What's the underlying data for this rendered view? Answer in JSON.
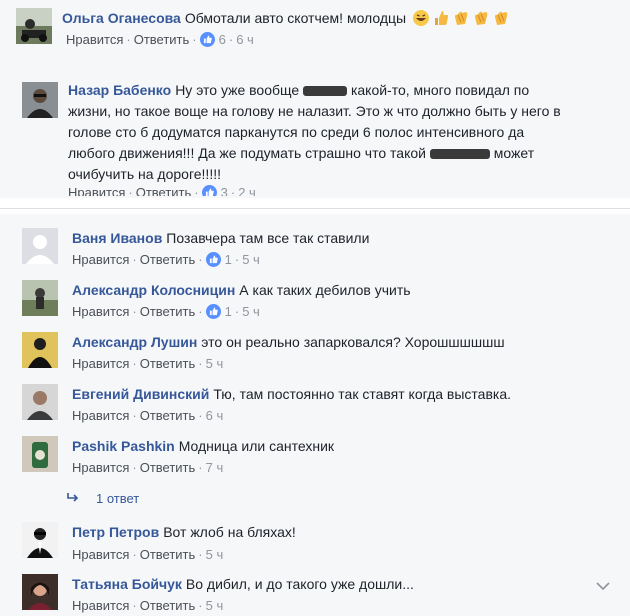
{
  "comments": [
    {
      "author": "Ольга Оганесова",
      "text": "Обмотали авто скотчем! молодцы",
      "like_label": "Нравится",
      "reply_label": "Ответить",
      "likes": "6",
      "time": "6 ч"
    },
    {
      "author": "Назар Бабенко",
      "text_part1": "Ну это уже вообще",
      "text_part2": "какой-то, много повидал по",
      "text_line2": "жизни, но такое воще на голову не налазит. Это ж что должно быть у него в",
      "text_line3": "голове сто б додуматся парканутся по среди 6 полос интенсивного да",
      "text_line4_part1": "любого движения!!! Да же подумать страшно что такой",
      "text_line4_part2": "может",
      "text_line5": "очибучить на дороге!!!!!",
      "like_label": "Нравится",
      "reply_label": "Ответить",
      "likes": "3",
      "time": "2 ч"
    }
  ],
  "replies": [
    {
      "author": "Ваня Иванов",
      "text": "Позавчера там все так ставили",
      "like_label": "Нравится",
      "reply_label": "Ответить",
      "likes": "1",
      "time": "5 ч"
    },
    {
      "author": "Александр Колосницин",
      "text": "А как таких дебилов учить",
      "like_label": "Нравится",
      "reply_label": "Ответить",
      "likes": "1",
      "time": "5 ч"
    },
    {
      "author": "Александр Лушин",
      "text": "это он реально запарковался? Хорошшшшшш",
      "like_label": "Нравится",
      "reply_label": "Ответить",
      "time": "5 ч"
    },
    {
      "author": "Евгений Дивинский",
      "text": "Тю, там постоянно так ставят когда выставка.",
      "like_label": "Нравится",
      "reply_label": "Ответить",
      "time": "6 ч"
    },
    {
      "author": "Pashik Pashkin",
      "text": "Модница или сантехник",
      "like_label": "Нравится",
      "reply_label": "Ответить",
      "time": "7 ч"
    },
    {
      "author": "Петр Петров",
      "text": "Вот жлоб на бляхах!",
      "like_label": "Нравится",
      "reply_label": "Ответить",
      "time": "5 ч"
    },
    {
      "author": "Татьяна Бойчук",
      "text": "Во дибил, и до такого уже дошли...",
      "like_label": "Нравится",
      "reply_label": "Ответить",
      "time": "5 ч"
    }
  ],
  "reply_count_label": "1 ответ",
  "colors": {
    "link": "#365899",
    "meta": "#90949c",
    "like_badge": "#5890ff",
    "panel_bg": "#f6f7f9"
  },
  "icons": [
    "avatar",
    "like-icon",
    "laugh-emoji",
    "thumbs-up-emoji",
    "clap-emoji",
    "reply-arrow-icon",
    "chevron-down-icon"
  ]
}
